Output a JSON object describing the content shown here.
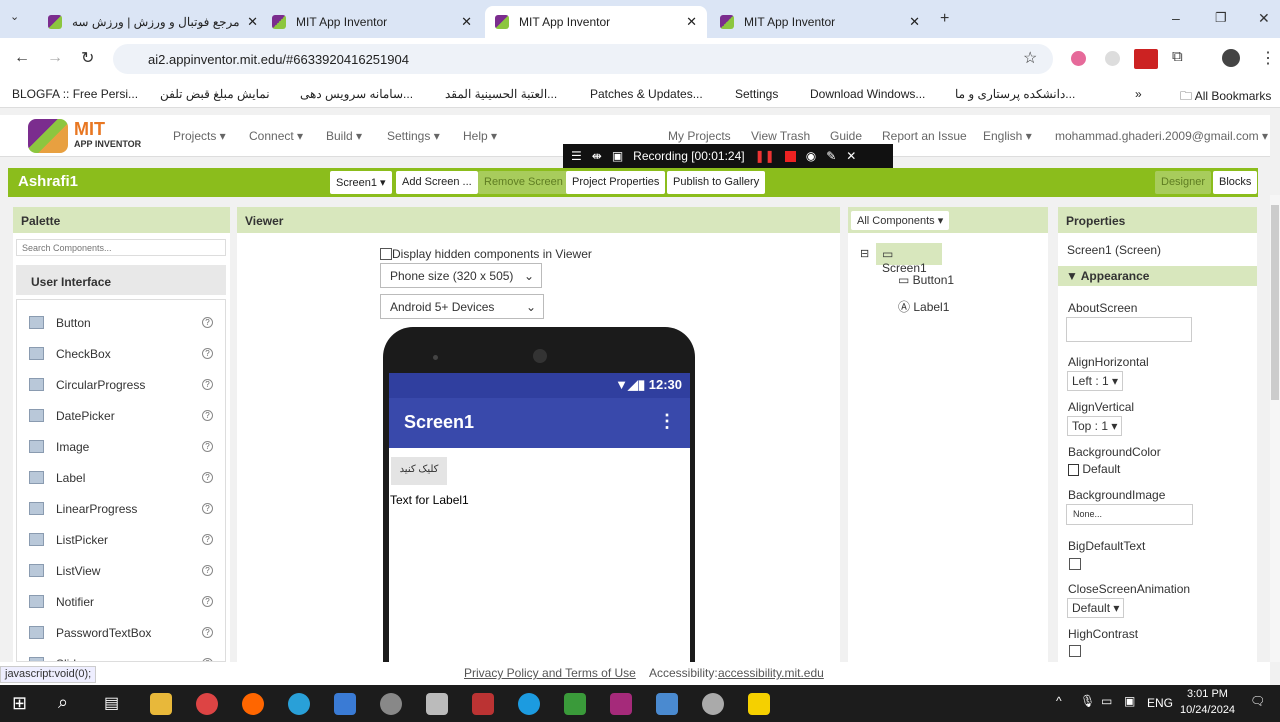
{
  "browser": {
    "tabs": [
      {
        "title": "مرجع فوتبال و ورزش | ورزش سه",
        "active": false
      },
      {
        "title": "MIT App Inventor",
        "active": false
      },
      {
        "title": "MIT App Inventor",
        "active": true
      },
      {
        "title": "MIT App Inventor",
        "active": false
      }
    ],
    "url": "ai2.appinventor.mit.edu/#6633920416251904",
    "bookmarks": [
      "BLOGFA :: Free Persi...",
      "نمایش مبلغ قبض تلفن",
      "سامانه سرویس دهی...",
      "العتبة الحسینیة المقد...",
      "Patches & Updates...",
      "Settings",
      "Download Windows...",
      "دانشکده پرستاری و ما..."
    ],
    "all_bookmarks": "All Bookmarks",
    "status_url": "javascript:void(0);"
  },
  "app": {
    "logo_top": "MIT",
    "logo_bottom": "APP INVENTOR",
    "menu": [
      "Projects ▾",
      "Connect ▾",
      "Build ▾",
      "Settings ▾",
      "Help ▾"
    ],
    "right_menu": [
      "My Projects",
      "View Trash",
      "Guide",
      "Report an Issue",
      "English ▾",
      "mohammad.ghaderi.2009@gmail.com ▾"
    ],
    "project": "Ashrafi1",
    "toolbar": {
      "screen": "Screen1 ▾",
      "add": "Add Screen ...",
      "remove": "Remove Screen",
      "props": "Project Properties",
      "publish": "Publish to Gallery",
      "designer": "Designer",
      "blocks": "Blocks"
    }
  },
  "recording": {
    "text": "Recording [00:01:24]"
  },
  "palette": {
    "title": "Palette",
    "search_placeholder": "Search Components...",
    "category": "User Interface",
    "items": [
      "Button",
      "CheckBox",
      "CircularProgress",
      "DatePicker",
      "Image",
      "Label",
      "LinearProgress",
      "ListPicker",
      "ListView",
      "Notifier",
      "PasswordTextBox",
      "Slider"
    ]
  },
  "viewer": {
    "title": "Viewer",
    "hidden_label": "Display hidden components in Viewer",
    "phone_size": "Phone size (320 x 505)",
    "devices": "Android 5+ Devices",
    "time": "12:30",
    "screen_title": "Screen1",
    "button_text": "کلیک کنید",
    "label_text": "Text for Label1"
  },
  "components": {
    "dropdown": "All Components ▾",
    "tree": [
      "Screen1",
      "Button1",
      "Label1"
    ]
  },
  "properties": {
    "title": "Properties",
    "component": "Screen1 (Screen)",
    "group": "Appearance",
    "about": "AboutScreen",
    "align_h": "AlignHorizontal",
    "align_h_val": "Left : 1 ▾",
    "align_v": "AlignVertical",
    "align_v_val": "Top : 1 ▾",
    "bg_color": "BackgroundColor",
    "bg_color_val": "Default",
    "bg_image": "BackgroundImage",
    "bg_image_val": "None...",
    "big_text": "BigDefaultText",
    "close_anim": "CloseScreenAnimation",
    "close_anim_val": "Default ▾",
    "high_contrast": "HighContrast"
  },
  "footer": {
    "privacy": "Privacy Policy and Terms of Use",
    "access_label": "Accessibility:",
    "access_link": "accessibility.mit.edu"
  },
  "taskbar": {
    "lang": "ENG",
    "time": "3:01 PM",
    "date": "10/24/2024"
  },
  "colors": {
    "green": "#8bbd1c",
    "appbar": "#3949ab"
  }
}
